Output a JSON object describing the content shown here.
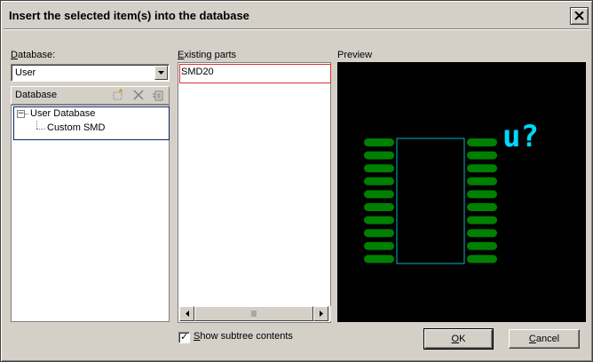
{
  "window": {
    "title": "Insert the selected item(s) into the database"
  },
  "database": {
    "label_prefix": "",
    "label_underlined": "D",
    "label_rest": "atabase:",
    "selected_value": "User"
  },
  "tree": {
    "header_label": "Database",
    "toolbar": [
      "new-folder-icon",
      "delete-icon",
      "properties-icon"
    ],
    "items": [
      {
        "label": "User Database",
        "expander": "−"
      },
      {
        "label": "Custom SMD"
      }
    ]
  },
  "existing_parts": {
    "label_underlined": "E",
    "label_rest": "xisting parts",
    "items": [
      "SMD20"
    ]
  },
  "preview": {
    "label": "Preview",
    "ref_designator": "u?",
    "pad_color": "#008000",
    "body_outline_color": "#00b8c8",
    "designator_color": "#00d8ff",
    "pads_per_side": 10
  },
  "show_subtree": {
    "label_underlined": "S",
    "label_rest": "how subtree contents",
    "checked": "✓"
  },
  "buttons": {
    "ok_underlined": "O",
    "ok_rest": "K",
    "cancel_prefix": "",
    "cancel_underlined": "C",
    "cancel_rest": "ancel"
  },
  "colors": {
    "dialog_bg": "#d4d0c8",
    "selection_frame": "#0a246a",
    "parts_item_border": "#e03030"
  }
}
